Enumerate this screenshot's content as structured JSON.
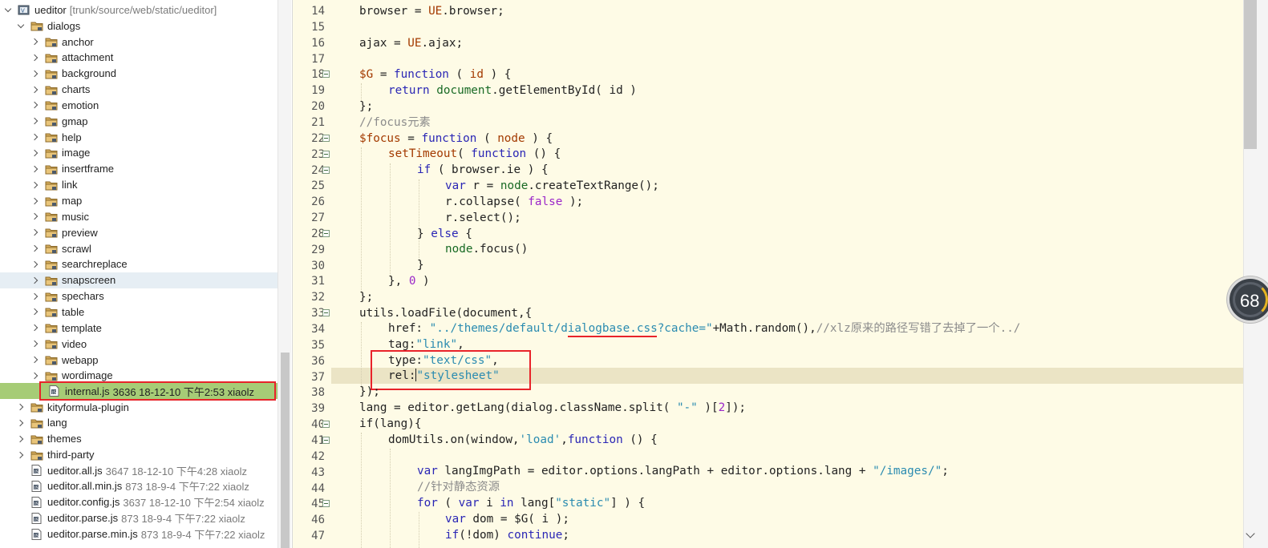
{
  "explorer": {
    "project": {
      "name": "ueditor",
      "meta": "[trunk/source/web/static/ueditor]"
    },
    "dialogs_folder": "dialogs",
    "dialog_children": [
      "anchor",
      "attachment",
      "background",
      "charts",
      "emotion",
      "gmap",
      "help",
      "image",
      "insertframe",
      "link",
      "map",
      "music",
      "preview",
      "scrawl",
      "searchreplace",
      "snapscreen",
      "spechars",
      "table",
      "template",
      "video",
      "webapp",
      "wordimage"
    ],
    "selected_file": {
      "name": "internal.js",
      "meta": "3636  18-12-10 下午2:53  xiaolz"
    },
    "top_folders": [
      "kityformula-plugin",
      "lang",
      "themes",
      "third-party"
    ],
    "root_files": [
      {
        "name": "ueditor.all.js",
        "meta": "3647  18-12-10 下午4:28  xiaolz"
      },
      {
        "name": "ueditor.all.min.js",
        "meta": "873  18-9-4 下午7:22  xiaolz"
      },
      {
        "name": "ueditor.config.js",
        "meta": "3637  18-12-10 下午2:54  xiaolz"
      },
      {
        "name": "ueditor.parse.js",
        "meta": "873  18-9-4 下午7:22  xiaolz"
      },
      {
        "name": "ueditor.parse.min.js",
        "meta": "873  18-9-4 下午7:22  xiaolz"
      }
    ]
  },
  "editor": {
    "line_numbers": [
      "14",
      "15",
      "16",
      "17",
      "18",
      "19",
      "20",
      "21",
      "22",
      "23",
      "24",
      "25",
      "26",
      "27",
      "28",
      "29",
      "30",
      "31",
      "32",
      "33",
      "34",
      "35",
      "36",
      "37",
      "38",
      "39",
      "40",
      "41",
      "42",
      "43",
      "44",
      "45",
      "46",
      "47"
    ],
    "code": {
      "l14_a": "browser = ",
      "l14_b": "UE",
      "l14_c": ".browser;",
      "l16_a": "ajax = ",
      "l16_b": "UE",
      "l16_c": ".ajax;",
      "l18_a": "$G",
      "l18_b": " = ",
      "l18_c": "function",
      "l18_d": " ( ",
      "l18_e": "id",
      "l18_f": " ) {",
      "l19_a": "return",
      "l19_b": " ",
      "l19_c": "document",
      "l19_d": ".getElementById( ",
      "l19_e": "id",
      "l19_f": " )",
      "l20": "};",
      "l21": "//focus元素",
      "l22_a": "$focus",
      "l22_b": " = ",
      "l22_c": "function",
      "l22_d": " ( ",
      "l22_e": "node",
      "l22_f": " ) {",
      "l23_a": "setTimeout",
      "l23_b": "( ",
      "l23_c": "function",
      "l23_d": " () {",
      "l24_a": "if",
      "l24_b": " ( browser.ie ) {",
      "l25_a": "var",
      "l25_b": " r = ",
      "l25_c": "node",
      "l25_d": ".createTextRange();",
      "l26_a": "r.collapse( ",
      "l26_b": "false",
      "l26_c": " );",
      "l27": "r.select();",
      "l28_a": "} ",
      "l28_b": "else",
      "l28_c": " {",
      "l29_a": "node",
      "l29_b": ".focus()",
      "l30": "}",
      "l31_a": "}, ",
      "l31_b": "0",
      "l31_c": " )",
      "l32": "};",
      "l33": "utils.loadFile(document,{",
      "l34_a": "href: ",
      "l34_b": "\"../themes/default/dialogbase.css?cache=\"",
      "l34_c": "+Math.random(),",
      "l34_d": "//xlz原来的路径写错了去掉了一个../",
      "l35_a": "tag:",
      "l35_b": "\"link\"",
      "l35_c": ",",
      "l36_a": "type:",
      "l36_b": "\"text/css\"",
      "l36_c": ",",
      "l37_a": "rel:",
      "l37_b": "\"stylesheet\"",
      "l38": "});",
      "l39_a": "lang = editor.getLang(dialog.className.split( ",
      "l39_b": "\"-\"",
      "l39_c": " )[",
      "l39_d": "2",
      "l39_e": "]);",
      "l40": "if(lang){",
      "l41_a": "domUtils.on(window,",
      "l41_b": "'load'",
      "l41_c": ",",
      "l41_d": "function",
      "l41_e": " () {",
      "l43_a": "var",
      "l43_b": " langImgPath = editor.options.langPath + editor.options.lang + ",
      "l43_c": "\"/images/\"",
      "l43_d": ";",
      "l44": "//针对静态资源",
      "l45_a": "for",
      "l45_b": " ( ",
      "l45_c": "var",
      "l45_d": " i ",
      "l45_e": "in",
      "l45_f": " lang[",
      "l45_g": "\"static\"",
      "l45_h": "] ) {",
      "l46_a": "var",
      "l46_b": " dom = $G( i );",
      "l47_a": "if",
      "l47_b": "(!dom) ",
      "l47_c": "continue",
      "l47_d": ";"
    }
  },
  "gauge": {
    "value": "68"
  },
  "colors": {
    "selection_highlight": "#a6cc76",
    "annotation_red": "#e8232a",
    "editor_background": "#fefbe6",
    "current_line": "#ebe4c5"
  }
}
